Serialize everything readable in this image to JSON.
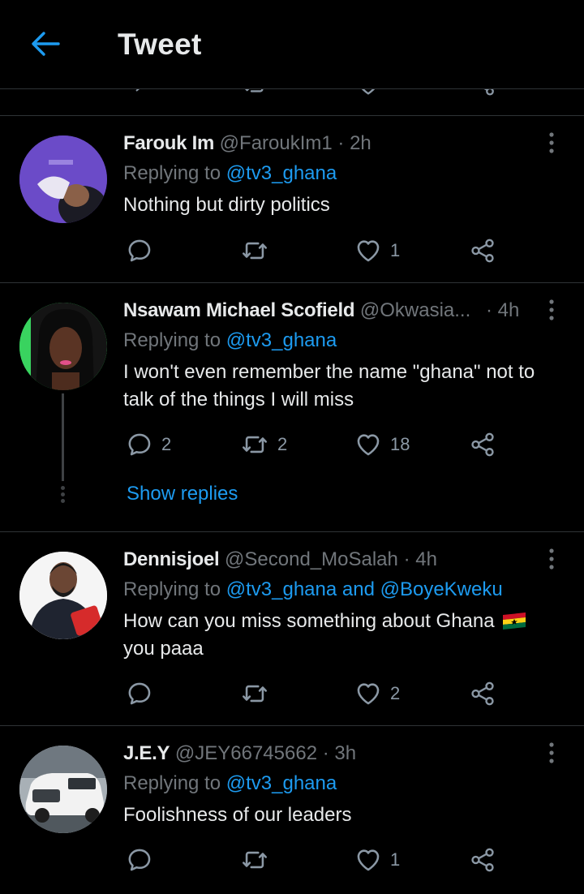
{
  "header": {
    "title": "Tweet"
  },
  "replying_prefix": "Replying to",
  "tweets": [
    {
      "name": "Farouk Im",
      "handle": "@FaroukIm1",
      "time": "· 2h",
      "replying_to": "@tv3_ghana",
      "text": "Nothing but dirty politics",
      "replies": "",
      "retweets": "",
      "likes": "1"
    },
    {
      "name": "Nsawam Michael Scofield",
      "handle": "@Okwasia...",
      "time": "· 4h",
      "replying_to": "@tv3_ghana",
      "text": "I won't even remember the name \"ghana\" not to talk of the things I will miss",
      "replies": "2",
      "retweets": "2",
      "likes": "18",
      "show_replies": "Show replies"
    },
    {
      "name": "Dennisjoel",
      "handle": "@Second_MoSalah",
      "time": "· 4h",
      "replying_to": "@tv3_ghana and @BoyeKweku",
      "text": "How can you miss something about Ghana",
      "text2": "you paaa",
      "replies": "",
      "retweets": "",
      "likes": "2"
    },
    {
      "name": "J.E.Y",
      "handle": "@JEY66745662",
      "time": "· 3h",
      "replying_to": "@tv3_ghana",
      "text": "Foolishness of our leaders",
      "replies": "",
      "retweets": "",
      "likes": "1"
    }
  ],
  "colors": {
    "accent": "#1d9bf0",
    "muted": "#71767b",
    "divider": "#2f3336"
  }
}
